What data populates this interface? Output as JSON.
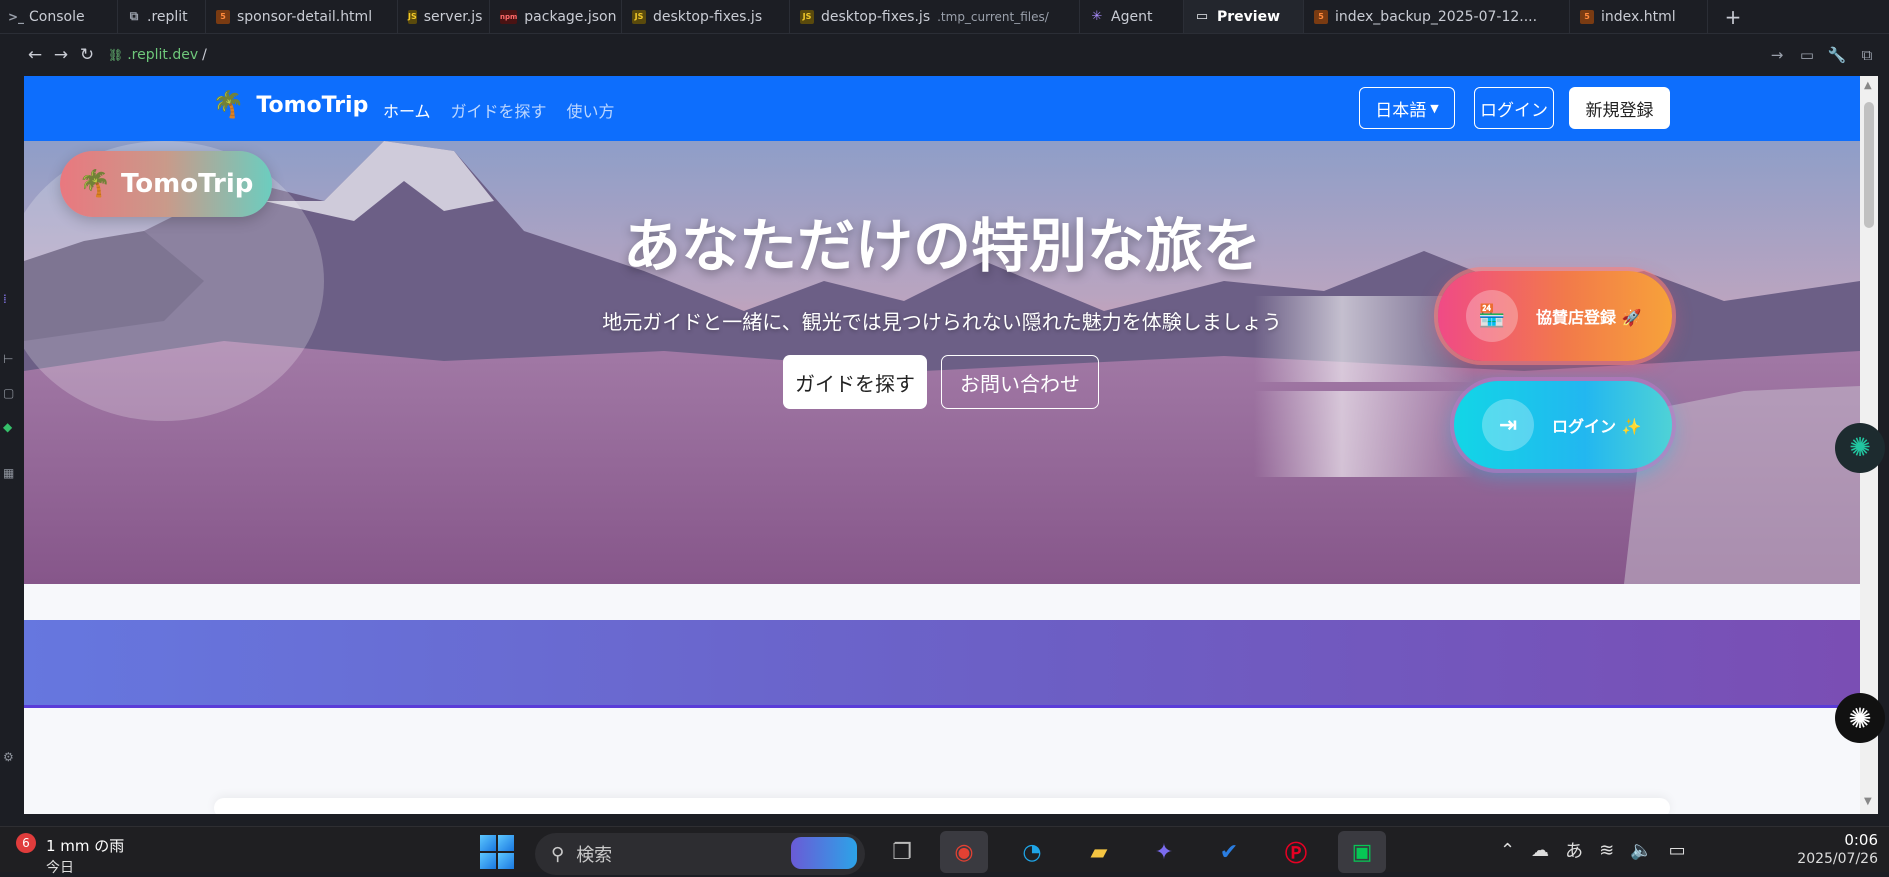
{
  "ide": {
    "tabs": [
      {
        "label": "Console",
        "icon": "console-icon",
        "active": false
      },
      {
        "label": ".replit",
        "icon": "replit-config-icon",
        "active": false
      },
      {
        "label": "sponsor-detail.html",
        "icon": "html-file-icon",
        "active": false
      },
      {
        "label": "server.js",
        "icon": "js-file-icon",
        "active": false
      },
      {
        "label": "package.json",
        "icon": "json-file-icon",
        "active": false
      },
      {
        "label": "desktop-fixes.js",
        "icon": "js-file-icon",
        "active": false
      },
      {
        "label": "desktop-fixes.js",
        "sublabel": ".tmp_current_files/",
        "icon": "js-file-icon",
        "active": false
      },
      {
        "label": "Agent",
        "icon": "agent-icon",
        "active": false
      },
      {
        "label": "Preview",
        "icon": "preview-monitor-icon",
        "active": true
      },
      {
        "label": "index_backup_2025-07-12....",
        "icon": "html-file-icon",
        "active": false
      },
      {
        "label": "index.html",
        "icon": "html-file-icon",
        "active": false
      }
    ],
    "new_tab_label": "+",
    "address": {
      "domain": ".replit.dev",
      "path": "/"
    }
  },
  "site": {
    "nav": {
      "brand": "TomoTrip",
      "links": [
        {
          "label": "ホーム",
          "active": true
        },
        {
          "label": "ガイドを探す",
          "active": false
        },
        {
          "label": "使い方",
          "active": false
        }
      ],
      "language": "日本語",
      "login": "ログイン",
      "signup": "新規登録"
    },
    "hero": {
      "floating_logo": "TomoTrip",
      "title": "あなただけの特別な旅を",
      "subtitle": "地元ガイドと一緒に、観光では見つけられない隠れた魅力を体験しましょう",
      "find_button": "ガイドを探す",
      "contact_button": "お問い合わせ",
      "sponsor_button": "協賛店登録 🚀",
      "login_button": "ログイン ✨"
    },
    "colors": {
      "nav": "#0d6efd",
      "sponsor_gradient_start": "#f04a86",
      "sponsor_gradient_end": "#f7a23a",
      "login_gradient_start": "#12d6e6",
      "login_gradient_end": "#4fd2d6",
      "band_start": "#6677df",
      "band_end": "#7a4eb4"
    }
  },
  "taskbar": {
    "weather": {
      "badge": "6",
      "text": "1 mm の雨",
      "day": "今日"
    },
    "search_placeholder": "検索",
    "ime": "あ",
    "clock": {
      "time": "0:06",
      "date": "2025/07/26"
    }
  }
}
